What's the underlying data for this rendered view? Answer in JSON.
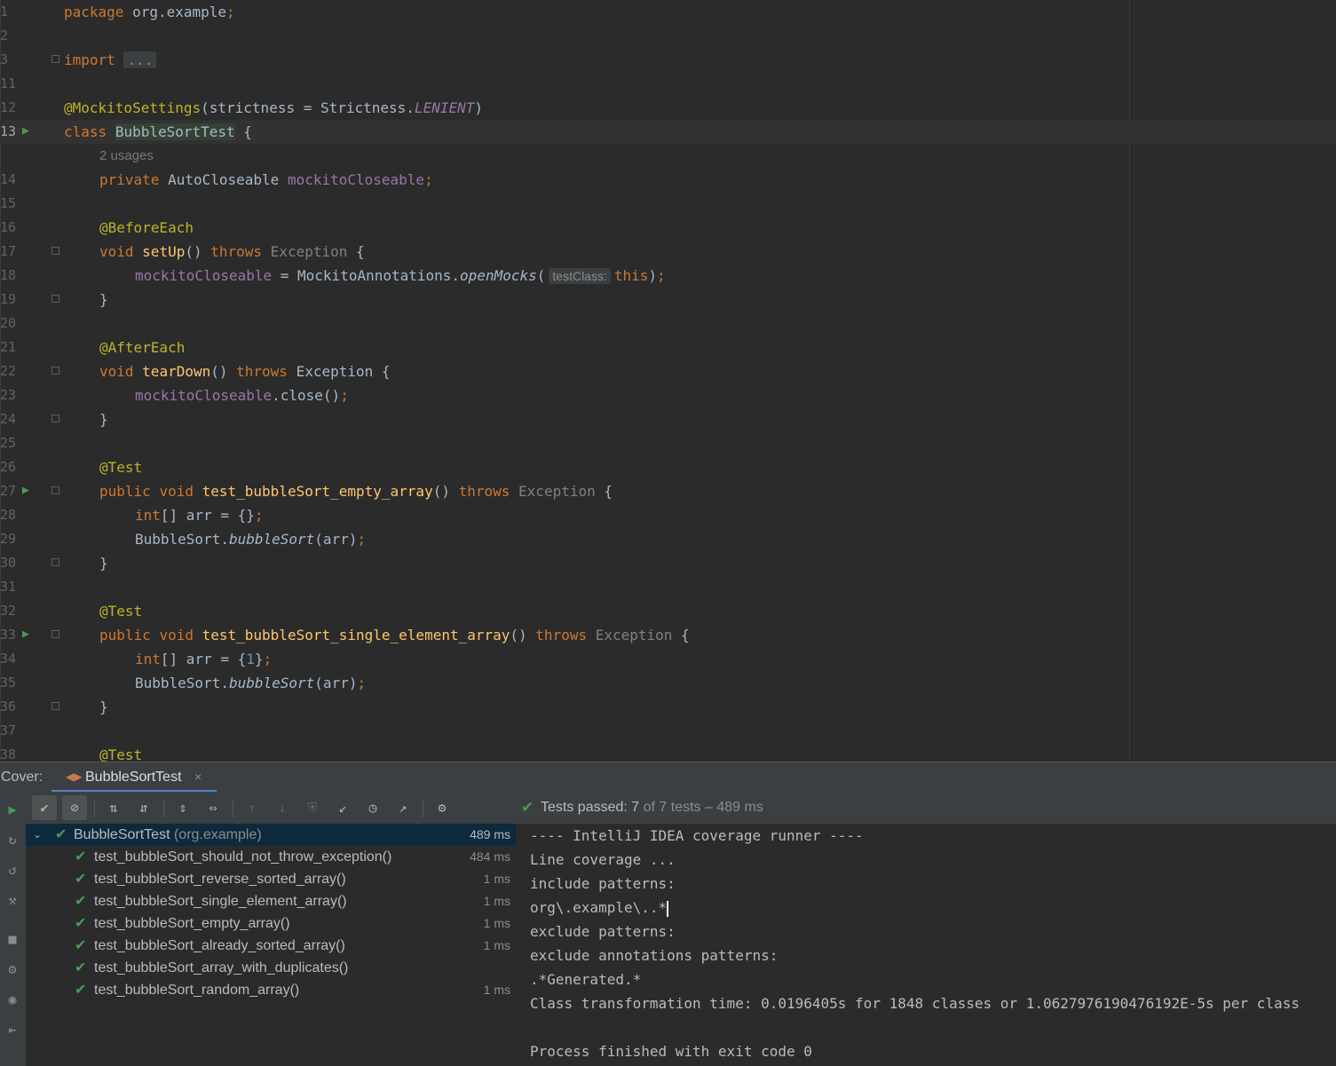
{
  "editor": {
    "line_numbers": [
      "1",
      "2",
      "3",
      "11",
      "12",
      "13",
      "",
      "14",
      "15",
      "16",
      "17",
      "18",
      "19",
      "20",
      "21",
      "22",
      "23",
      "24",
      "25",
      "26",
      "27",
      "28",
      "29",
      "30",
      "31",
      "32",
      "33",
      "34",
      "35",
      "36",
      "37",
      "38"
    ],
    "code": {
      "l1_kw": "package",
      "l1_rest": " org.example",
      "l1_semi": ";",
      "l3_kw": "import",
      "l3_fold": "...",
      "l12_ann": "@MockitoSettings",
      "l12_rest": "(strictness = Strictness.",
      "l12_const": "LENIENT",
      "l12_end": ")",
      "l13_kw": "class",
      "l13_cls": "BubbleSortTest",
      "l13_end": " {",
      "usages_hint": "2 usages",
      "l14_kw": "private",
      "l14_type": " AutoCloseable ",
      "l14_fld": "mockitoCloseable",
      "l14_semi": ";",
      "l16_ann": "@BeforeEach",
      "l17_kw": "void",
      "l17_fn": "setUp",
      "l17_mid": "() ",
      "l17_throws": "throws",
      "l17_exc": " Exception",
      "l17_end": " {",
      "l18_fld": "mockitoCloseable",
      "l18_mid": " = MockitoAnnotations.",
      "l18_method": "openMocks",
      "l18_paren": "(",
      "l18_hint": "testClass:",
      "l18_this": "this",
      "l18_close": ")",
      "l18_semi": ";",
      "close_brace": "}",
      "l21_ann": "@AfterEach",
      "l22_kw": "void",
      "l22_fn": "tearDown",
      "l22_mid": "() ",
      "l22_throws": "throws",
      "l22_exc": " Exception",
      "l22_end": " {",
      "l23_fld": "mockitoCloseable",
      "l23_rest": ".close()",
      "l23_semi": ";",
      "test_ann": "@Test",
      "l27_kw1": "public",
      "l27_kw2": "void",
      "l27_fn": "test_bubbleSort_empty_array",
      "l27_mid": "() ",
      "l27_throws": "throws",
      "l27_exc": " Exception",
      "l27_end": " {",
      "int_kw": "int",
      "arr_decl": "[] arr = {",
      "l28_close": "}",
      "semi": ";",
      "bs_call": "BubbleSort.",
      "bs_method": "bubbleSort",
      "bs_args": "(arr)",
      "l33_kw1": "public",
      "l33_kw2": "void",
      "l33_fn": "test_bubbleSort_single_element_array",
      "l33_mid": "() ",
      "l33_throws": "throws",
      "l33_exc": " Exception",
      "l33_end": " {",
      "l34_num": "1",
      "l34_close": "}"
    }
  },
  "tool_window": {
    "title": "Cover:",
    "tab_label": "BubbleSortTest",
    "tab_close": "×",
    "status": {
      "prefix": "Tests passed: ",
      "passed": "7",
      "of_text": " of 7 tests – 489 ms"
    },
    "tree": {
      "root_label": "BubbleSortTest",
      "root_pkg": " (org.example)",
      "root_time": "489 ms",
      "items": [
        {
          "label": "test_bubbleSort_should_not_throw_exception()",
          "time": "484 ms"
        },
        {
          "label": "test_bubbleSort_reverse_sorted_array()",
          "time": "1 ms"
        },
        {
          "label": "test_bubbleSort_single_element_array()",
          "time": "1 ms"
        },
        {
          "label": "test_bubbleSort_empty_array()",
          "time": "1 ms"
        },
        {
          "label": "test_bubbleSort_already_sorted_array()",
          "time": "1 ms"
        },
        {
          "label": "test_bubbleSort_array_with_duplicates()",
          "time": ""
        },
        {
          "label": "test_bubbleSort_random_array()",
          "time": "1 ms"
        }
      ]
    },
    "console": {
      "lines": [
        "---- IntelliJ IDEA coverage runner ----",
        "Line coverage ...",
        "include patterns:",
        "org\\.example\\..*",
        "exclude patterns:",
        "exclude annotations patterns:",
        ".*Generated.*",
        "Class transformation time: 0.0196405s for 1848 classes or 1.0627976190476192E-5s per class",
        "",
        "Process finished with exit code 0"
      ]
    }
  },
  "colors": {
    "accent": "#4a88c7",
    "pass_green": "#499c54",
    "keyword": "#cc7832",
    "annotation": "#bbb529",
    "field": "#9876aa"
  }
}
